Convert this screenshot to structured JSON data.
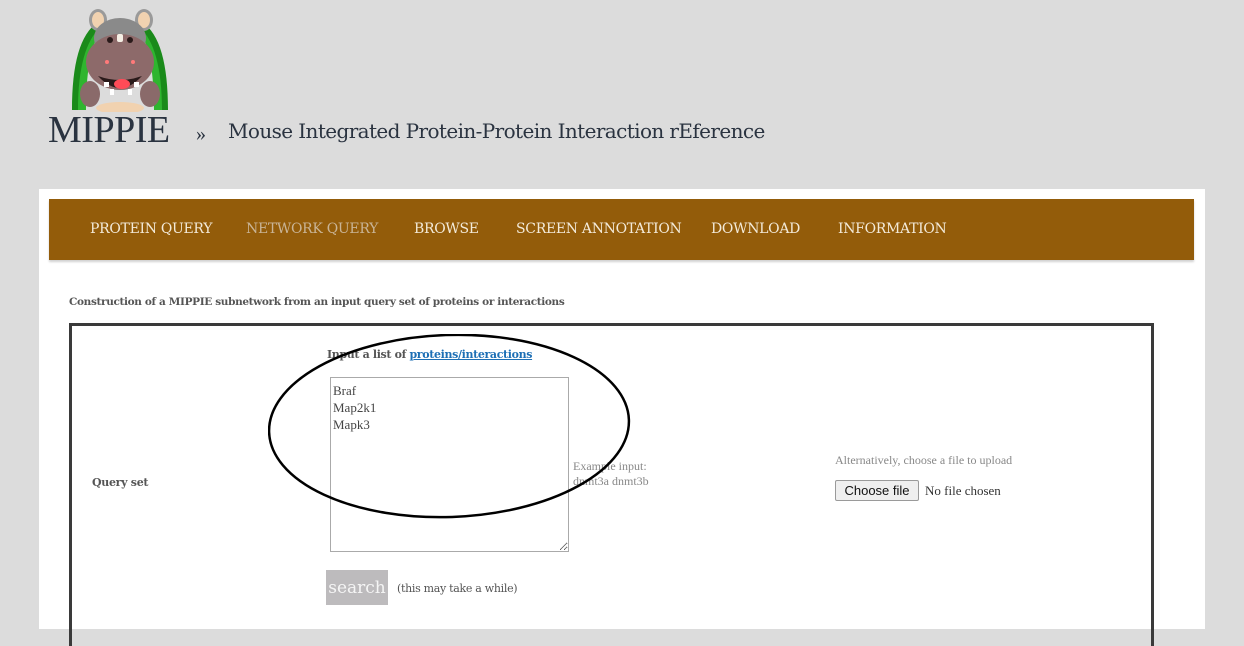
{
  "header": {
    "logo_icon": "hippo-mascot-logo",
    "brand": "MIPPIE",
    "separator": "»",
    "tagline": "Mouse Integrated Protein-Protein Interaction rEference"
  },
  "nav": {
    "items": [
      {
        "label": "PROTEIN QUERY",
        "active": false
      },
      {
        "label": "NETWORK QUERY",
        "active": true
      },
      {
        "label": "BROWSE",
        "active": false
      },
      {
        "label": "SCREEN ANNOTATION",
        "active": false
      },
      {
        "label": "DOWNLOAD",
        "active": false
      },
      {
        "label": "INFORMATION",
        "active": false
      }
    ]
  },
  "main": {
    "subtitle": "Construction of a MIPPIE subnetwork from an input query set of proteins or interactions",
    "query_set_label": "Query set",
    "input_label_prefix": "Input a list of ",
    "input_label_link": "proteins/interactions",
    "textarea_value": "Braf\nMap2k1\nMapk3",
    "example_line1": "Example input:",
    "example_line2": "dnmt3a dnmt3b",
    "upload_label": "Alternatively, choose a file to upload",
    "choose_file_label": "Choose file",
    "file_status": "No file chosen",
    "search_label": "search",
    "search_hint": "(this may take a while)"
  },
  "colors": {
    "navbar": "#935c0a",
    "nav_text": "#f3ead9",
    "nav_active_text": "#c9b496",
    "link": "#1d6fb5",
    "page_bg": "#dcdcdc"
  },
  "annotation": {
    "shape": "ellipse",
    "target": "query-textarea"
  }
}
